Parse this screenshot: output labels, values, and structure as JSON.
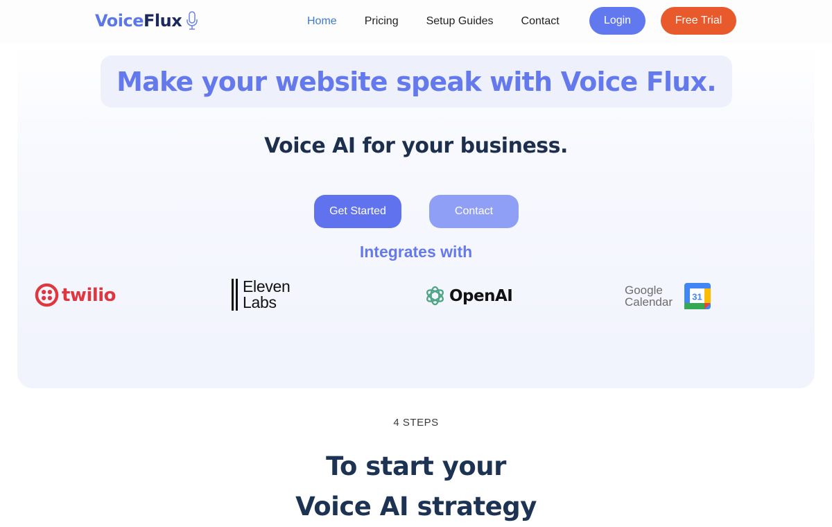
{
  "brand": {
    "name_part1": "Voice",
    "name_part2": "Flux",
    "icon": "microphone-icon",
    "colors": {
      "primary": "#6278ee",
      "dark": "#1b2a5e",
      "accent": "#e85a2c"
    }
  },
  "nav": {
    "links": [
      {
        "label": "Home",
        "active": true
      },
      {
        "label": "Pricing",
        "active": false
      },
      {
        "label": "Setup Guides",
        "active": false
      },
      {
        "label": "Contact",
        "active": false
      }
    ],
    "login_label": "Login",
    "trial_label": "Free Trial"
  },
  "hero": {
    "headline": "Make your website speak with Voice Flux.",
    "subheadline": "Voice AI for your business.",
    "primary_cta": "Get Started",
    "secondary_cta": "Contact",
    "integrations_title": "Integrates with",
    "integrations": [
      {
        "name": "twilio",
        "icon": "twilio-logo-icon"
      },
      {
        "name_line1": "Eleven",
        "name_line2": "Labs",
        "icon": "elevenlabs-logo-icon"
      },
      {
        "name": "OpenAI",
        "icon": "openai-logo-icon"
      },
      {
        "name_line1": "Google",
        "name_line2": "Calendar",
        "badge": "31",
        "icon": "google-calendar-icon"
      }
    ]
  },
  "steps": {
    "label": "4 STEPS",
    "title_line1": "To start your",
    "title_line2": "Voice AI strategy"
  }
}
